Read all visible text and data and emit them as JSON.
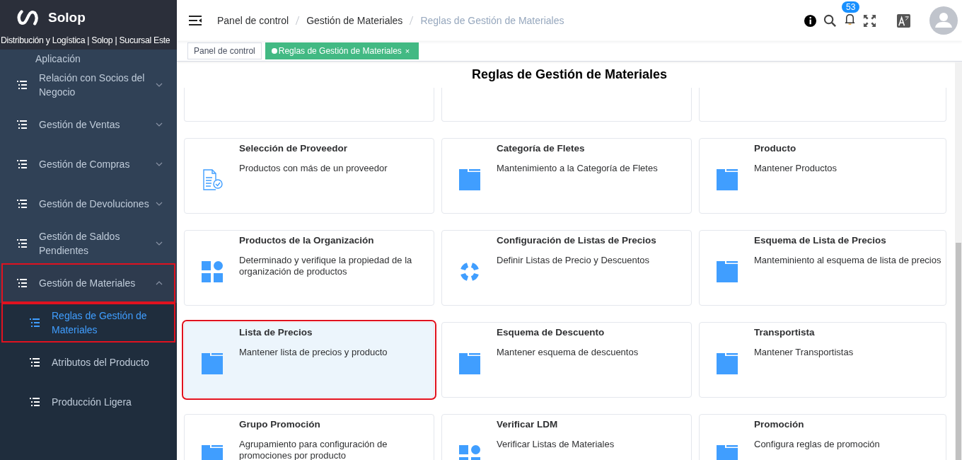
{
  "brand": {
    "name": "Solop",
    "subtitle": "Distribución y Logística | Solop | Sucursal Este"
  },
  "sidebar": {
    "items": [
      {
        "label": "Aplicación",
        "kind": "partial"
      },
      {
        "label": "Relación con Socios del Negocio",
        "kind": "group",
        "expanded": false,
        "highlighted": false
      },
      {
        "label": "Gestión de Ventas",
        "kind": "group",
        "expanded": false,
        "highlighted": false
      },
      {
        "label": "Gestión de Compras",
        "kind": "group",
        "expanded": false,
        "highlighted": false
      },
      {
        "label": "Gestión de Devoluciones",
        "kind": "group",
        "expanded": false,
        "highlighted": false
      },
      {
        "label": "Gestión de Saldos Pendientes",
        "kind": "group",
        "expanded": false,
        "highlighted": false
      },
      {
        "label": "Gestión de Materiales",
        "kind": "group",
        "expanded": true,
        "highlighted": true,
        "children": [
          {
            "label": "Reglas de Gestión de Materiales",
            "selected": true,
            "highlighted": true
          },
          {
            "label": "Atributos del Producto",
            "selected": false,
            "highlighted": false
          },
          {
            "label": "Producción Ligera",
            "selected": false,
            "highlighted": false
          }
        ]
      }
    ]
  },
  "breadcrumb": [
    {
      "label": "Panel de control",
      "current": false
    },
    {
      "label": "Gestión de Materiales",
      "current": false
    },
    {
      "label": "Reglas de Gestión de Materiales",
      "current": true
    }
  ],
  "notifications": {
    "count": "53"
  },
  "tags": [
    {
      "label": "Panel de control",
      "selected": false
    },
    {
      "label": "Reglas de Gestión de Materiales",
      "selected": true,
      "close": "×"
    }
  ],
  "page": {
    "title": "Reglas de Gestión de Materiales"
  },
  "cards": [
    {
      "title": "Selección de Proveedor",
      "description": "Productos con más de un proveedor",
      "kind": "checklist",
      "highlighted": false
    },
    {
      "title": "Categoría de Fletes",
      "description": "Mantenimiento a la Categoría de Fletes",
      "kind": "folder",
      "highlighted": false
    },
    {
      "title": "Producto",
      "description": "Mantener Productos",
      "kind": "folder",
      "highlighted": false
    },
    {
      "title": "Productos de la Organización",
      "description": "Determinado y verifique la propiedad de la organización de productos",
      "kind": "grid",
      "highlighted": false
    },
    {
      "title": "Configuración de Listas de Precios",
      "description": "Definir Listas de Precio y Descuentos",
      "kind": "lifebuoy",
      "highlighted": false
    },
    {
      "title": "Esquema de Lista de Precios",
      "description": "Manteminiento al esquema de lista de precios",
      "kind": "folder",
      "highlighted": false
    },
    {
      "title": "Lista de Precios",
      "description": "Mantener lista de precios y producto",
      "kind": "folder",
      "highlighted": true
    },
    {
      "title": "Esquema de Descuento",
      "description": "Mantener esquema de descuentos",
      "kind": "folder",
      "highlighted": false
    },
    {
      "title": "Transportista",
      "description": "Mantener Transportistas",
      "kind": "folder",
      "highlighted": false
    },
    {
      "title": "Grupo Promoción",
      "description": "Agrupamiento para configuración de promociones por producto",
      "kind": "folder",
      "highlighted": false
    },
    {
      "title": "Verificar LDM",
      "description": "Verificar Listas de Materiales",
      "kind": "grid",
      "highlighted": false
    },
    {
      "title": "Promoción",
      "description": "Configura reglas de promoción",
      "kind": "folder",
      "highlighted": false
    }
  ]
}
